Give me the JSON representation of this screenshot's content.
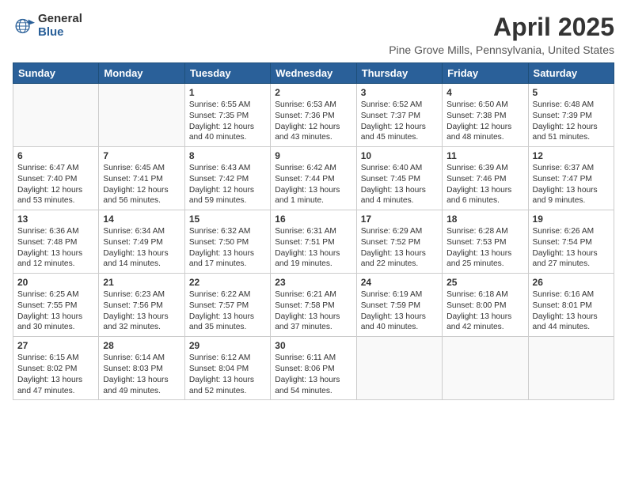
{
  "header": {
    "logo_line1": "General",
    "logo_line2": "Blue",
    "title": "April 2025",
    "subtitle": "Pine Grove Mills, Pennsylvania, United States"
  },
  "days_of_week": [
    "Sunday",
    "Monday",
    "Tuesday",
    "Wednesday",
    "Thursday",
    "Friday",
    "Saturday"
  ],
  "weeks": [
    [
      {
        "day": "",
        "info": ""
      },
      {
        "day": "",
        "info": ""
      },
      {
        "day": "1",
        "info": "Sunrise: 6:55 AM\nSunset: 7:35 PM\nDaylight: 12 hours and 40 minutes."
      },
      {
        "day": "2",
        "info": "Sunrise: 6:53 AM\nSunset: 7:36 PM\nDaylight: 12 hours and 43 minutes."
      },
      {
        "day": "3",
        "info": "Sunrise: 6:52 AM\nSunset: 7:37 PM\nDaylight: 12 hours and 45 minutes."
      },
      {
        "day": "4",
        "info": "Sunrise: 6:50 AM\nSunset: 7:38 PM\nDaylight: 12 hours and 48 minutes."
      },
      {
        "day": "5",
        "info": "Sunrise: 6:48 AM\nSunset: 7:39 PM\nDaylight: 12 hours and 51 minutes."
      }
    ],
    [
      {
        "day": "6",
        "info": "Sunrise: 6:47 AM\nSunset: 7:40 PM\nDaylight: 12 hours and 53 minutes."
      },
      {
        "day": "7",
        "info": "Sunrise: 6:45 AM\nSunset: 7:41 PM\nDaylight: 12 hours and 56 minutes."
      },
      {
        "day": "8",
        "info": "Sunrise: 6:43 AM\nSunset: 7:42 PM\nDaylight: 12 hours and 59 minutes."
      },
      {
        "day": "9",
        "info": "Sunrise: 6:42 AM\nSunset: 7:44 PM\nDaylight: 13 hours and 1 minute."
      },
      {
        "day": "10",
        "info": "Sunrise: 6:40 AM\nSunset: 7:45 PM\nDaylight: 13 hours and 4 minutes."
      },
      {
        "day": "11",
        "info": "Sunrise: 6:39 AM\nSunset: 7:46 PM\nDaylight: 13 hours and 6 minutes."
      },
      {
        "day": "12",
        "info": "Sunrise: 6:37 AM\nSunset: 7:47 PM\nDaylight: 13 hours and 9 minutes."
      }
    ],
    [
      {
        "day": "13",
        "info": "Sunrise: 6:36 AM\nSunset: 7:48 PM\nDaylight: 13 hours and 12 minutes."
      },
      {
        "day": "14",
        "info": "Sunrise: 6:34 AM\nSunset: 7:49 PM\nDaylight: 13 hours and 14 minutes."
      },
      {
        "day": "15",
        "info": "Sunrise: 6:32 AM\nSunset: 7:50 PM\nDaylight: 13 hours and 17 minutes."
      },
      {
        "day": "16",
        "info": "Sunrise: 6:31 AM\nSunset: 7:51 PM\nDaylight: 13 hours and 19 minutes."
      },
      {
        "day": "17",
        "info": "Sunrise: 6:29 AM\nSunset: 7:52 PM\nDaylight: 13 hours and 22 minutes."
      },
      {
        "day": "18",
        "info": "Sunrise: 6:28 AM\nSunset: 7:53 PM\nDaylight: 13 hours and 25 minutes."
      },
      {
        "day": "19",
        "info": "Sunrise: 6:26 AM\nSunset: 7:54 PM\nDaylight: 13 hours and 27 minutes."
      }
    ],
    [
      {
        "day": "20",
        "info": "Sunrise: 6:25 AM\nSunset: 7:55 PM\nDaylight: 13 hours and 30 minutes."
      },
      {
        "day": "21",
        "info": "Sunrise: 6:23 AM\nSunset: 7:56 PM\nDaylight: 13 hours and 32 minutes."
      },
      {
        "day": "22",
        "info": "Sunrise: 6:22 AM\nSunset: 7:57 PM\nDaylight: 13 hours and 35 minutes."
      },
      {
        "day": "23",
        "info": "Sunrise: 6:21 AM\nSunset: 7:58 PM\nDaylight: 13 hours and 37 minutes."
      },
      {
        "day": "24",
        "info": "Sunrise: 6:19 AM\nSunset: 7:59 PM\nDaylight: 13 hours and 40 minutes."
      },
      {
        "day": "25",
        "info": "Sunrise: 6:18 AM\nSunset: 8:00 PM\nDaylight: 13 hours and 42 minutes."
      },
      {
        "day": "26",
        "info": "Sunrise: 6:16 AM\nSunset: 8:01 PM\nDaylight: 13 hours and 44 minutes."
      }
    ],
    [
      {
        "day": "27",
        "info": "Sunrise: 6:15 AM\nSunset: 8:02 PM\nDaylight: 13 hours and 47 minutes."
      },
      {
        "day": "28",
        "info": "Sunrise: 6:14 AM\nSunset: 8:03 PM\nDaylight: 13 hours and 49 minutes."
      },
      {
        "day": "29",
        "info": "Sunrise: 6:12 AM\nSunset: 8:04 PM\nDaylight: 13 hours and 52 minutes."
      },
      {
        "day": "30",
        "info": "Sunrise: 6:11 AM\nSunset: 8:06 PM\nDaylight: 13 hours and 54 minutes."
      },
      {
        "day": "",
        "info": ""
      },
      {
        "day": "",
        "info": ""
      },
      {
        "day": "",
        "info": ""
      }
    ]
  ]
}
